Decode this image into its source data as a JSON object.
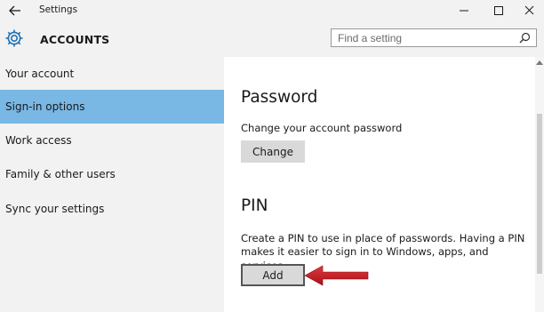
{
  "window": {
    "title": "Settings",
    "controls": {
      "minimize": "minimize-icon",
      "maximize": "maximize-icon",
      "close": "close-icon"
    }
  },
  "header": {
    "icon": "gear-icon",
    "title": "ACCOUNTS",
    "search": {
      "placeholder": "Find a setting",
      "value": ""
    }
  },
  "sidebar": {
    "items": [
      {
        "label": "Your account",
        "selected": false
      },
      {
        "label": "Sign-in options",
        "selected": true
      },
      {
        "label": "Work access",
        "selected": false
      },
      {
        "label": "Family & other users",
        "selected": false
      },
      {
        "label": "Sync your settings",
        "selected": false
      }
    ]
  },
  "main": {
    "password": {
      "heading": "Password",
      "description": "Change your account password",
      "button_label": "Change"
    },
    "pin": {
      "heading": "PIN",
      "description_line1": "Create a PIN to use in place of passwords. Having a PIN",
      "description_line2": "makes it easier to sign in to Windows, apps, and services.",
      "button_label": "Add"
    }
  },
  "colors": {
    "selected_nav": "#79b7e4",
    "chrome_bg": "#f2f2f2",
    "button_bg": "#d9d9d9",
    "annotation_arrow": "#c0161d"
  }
}
